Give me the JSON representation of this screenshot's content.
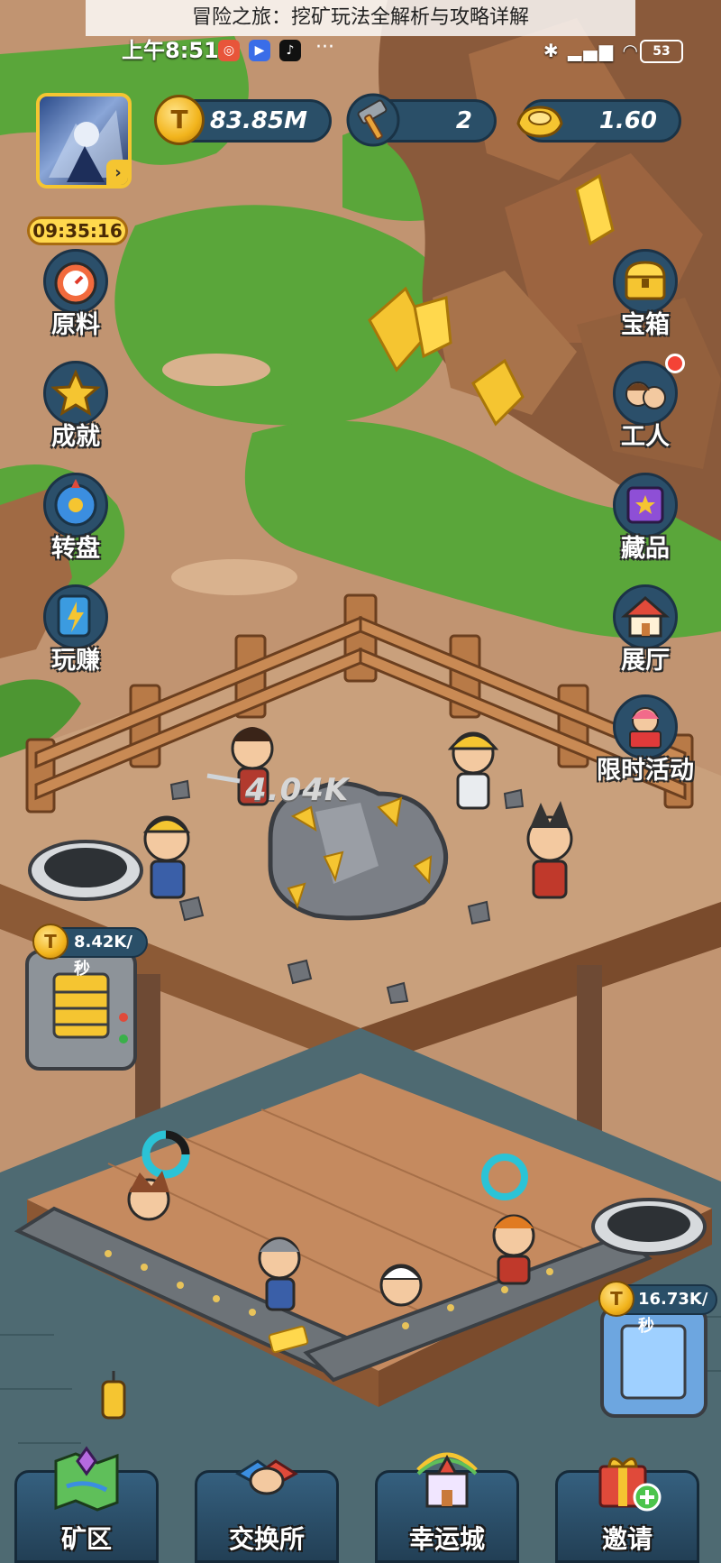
{
  "caption": "冒险之旅：挖矿玩法全解析与攻略详解",
  "status_bar": {
    "time": "上午8:51",
    "battery": "53"
  },
  "resources": {
    "coins": "83.85M",
    "hammers": "2",
    "gold_ingots": "1.60"
  },
  "timer": "09:35:16",
  "left_menu": [
    {
      "label": "原料",
      "icon": "clock-icon"
    },
    {
      "label": "成就",
      "icon": "star-icon"
    },
    {
      "label": "转盘",
      "icon": "wheel-icon"
    },
    {
      "label": "玩赚",
      "icon": "lightning-card-icon"
    }
  ],
  "right_menu": [
    {
      "label": "宝箱",
      "icon": "treasure-chest-icon"
    },
    {
      "label": "工人",
      "icon": "workers-icon"
    },
    {
      "label": "藏品",
      "icon": "collection-book-icon"
    },
    {
      "label": "展厅",
      "icon": "house-icon"
    },
    {
      "label": "限时活动",
      "icon": "gift-girl-icon"
    }
  ],
  "damage_text": "4.04K",
  "mine_rate": "8.42K/秒",
  "factory_rate": "16.73K/秒",
  "coin_symbol": "T",
  "bottom_nav": [
    {
      "label": "矿区",
      "icon": "map-icon"
    },
    {
      "label": "交换所",
      "icon": "handshake-icon"
    },
    {
      "label": "幸运城",
      "icon": "castle-icon"
    },
    {
      "label": "邀请",
      "icon": "gift-plus-icon"
    }
  ],
  "colors": {
    "grass": "#5aa63a",
    "dirt": "#c79a74",
    "panel": "#2a4f68",
    "gold": "#f5c531",
    "water": "#4e6a72"
  }
}
